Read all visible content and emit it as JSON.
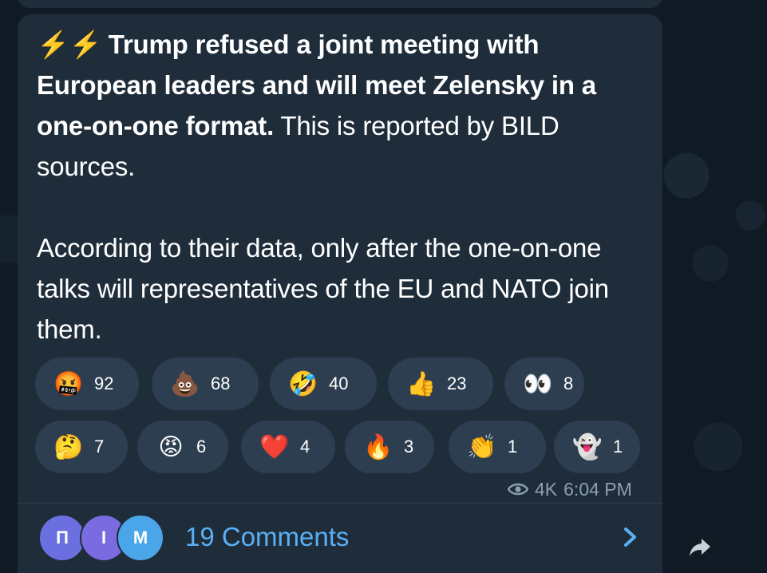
{
  "message": {
    "bolts": "⚡⚡",
    "headline": "Trump refused a joint meeting with European leaders and will meet Zelensky in a one-on-one format.",
    "tail": " This is reported by BILD sources.",
    "paragraph2": "According to their data, only after the one-on-one talks will representatives of the EU and NATO join them."
  },
  "reactions": [
    {
      "emoji": "🤬",
      "count": "92"
    },
    {
      "emoji": "💩",
      "count": "68"
    },
    {
      "emoji": "🤣",
      "count": "40"
    },
    {
      "emoji": "👍",
      "count": "23"
    },
    {
      "emoji": "👀",
      "count": "8"
    },
    {
      "emoji": "🤔",
      "count": "7"
    },
    {
      "emoji": "😡",
      "count": "6"
    },
    {
      "emoji": "❤️",
      "count": "4"
    },
    {
      "emoji": "🔥",
      "count": "3"
    },
    {
      "emoji": "👏",
      "count": "1"
    },
    {
      "emoji": "👻",
      "count": "1"
    }
  ],
  "meta": {
    "views": "4K",
    "time": "6:04 PM"
  },
  "comments": {
    "label": "19 Comments",
    "avatars": [
      {
        "initial": "П",
        "color": "#6b6fe0"
      },
      {
        "initial": "I",
        "color": "#7a6be0"
      },
      {
        "initial": "M",
        "color": "#4aa6e8"
      }
    ]
  },
  "icons": {
    "views": "eye-icon",
    "open": "chevron-right-icon",
    "share": "share-icon"
  },
  "colors": {
    "bubble": "#1f2d3b",
    "pill": "#2c3e50",
    "link": "#5ab0f5",
    "meta": "#8b9fb2"
  }
}
